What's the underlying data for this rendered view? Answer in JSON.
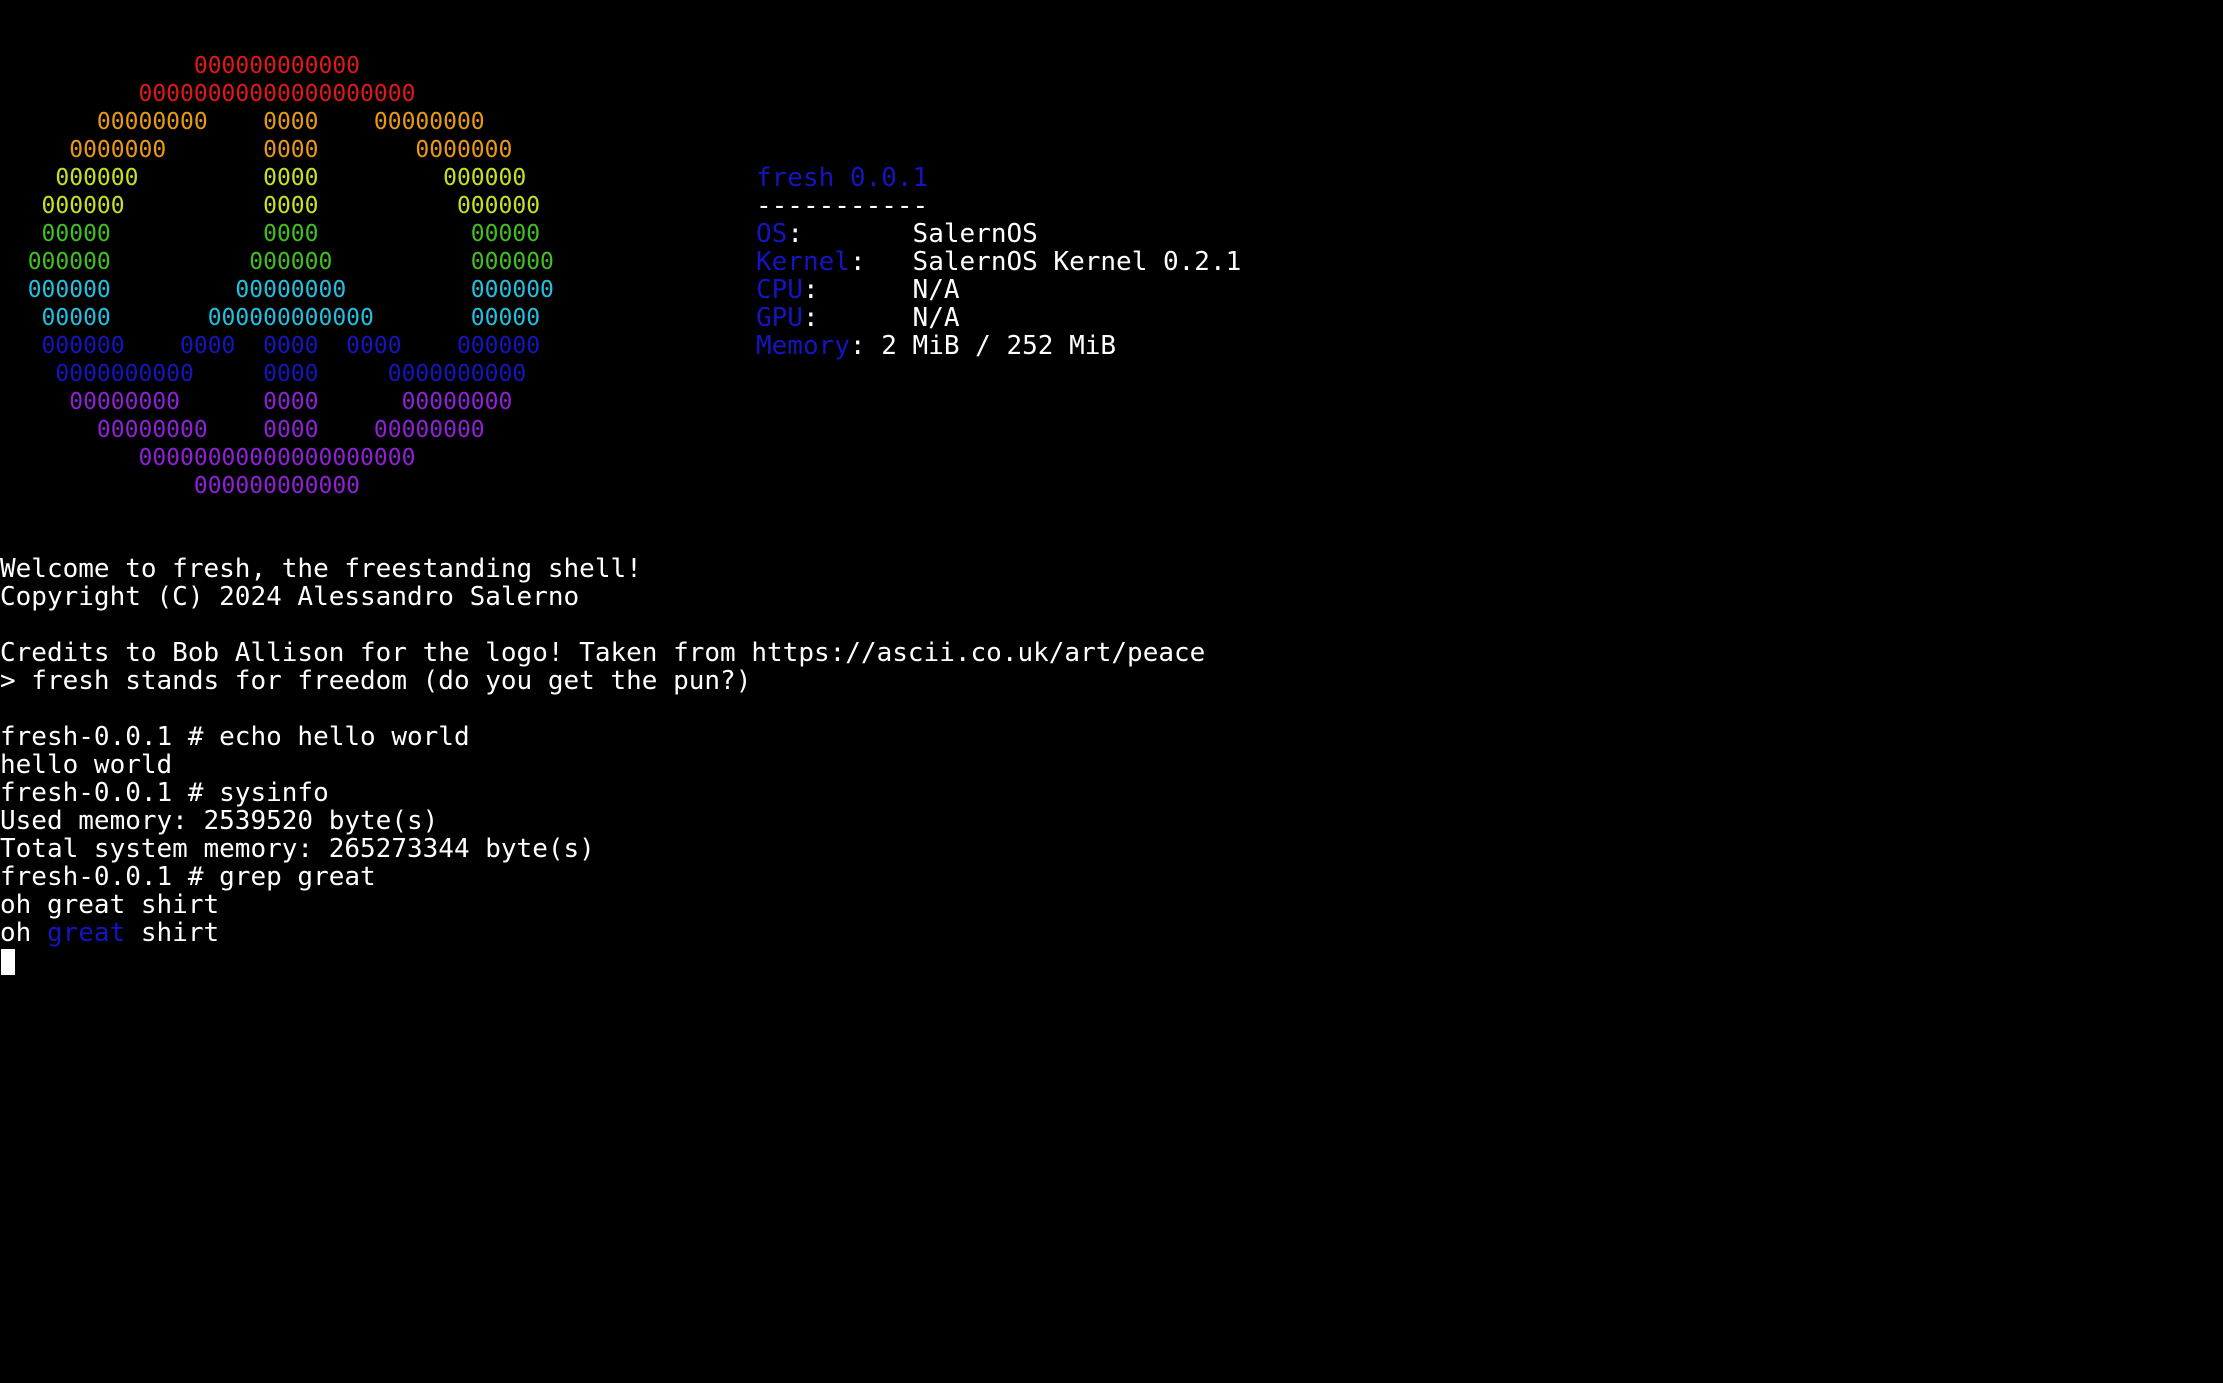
{
  "colors": {
    "background": "#000000",
    "text": "#ffffff",
    "accent_blue": "#1515c0",
    "logo": [
      "#e01818",
      "#e01818",
      "#e89a10",
      "#e89a10",
      "#c8e020",
      "#c8e020",
      "#40c020",
      "#40c020",
      "#20c0e0",
      "#20c0e0",
      "#1515c0",
      "#1515c0",
      "#9020d8",
      "#9020d8",
      "#9020d8",
      "#9020d8"
    ]
  },
  "logo": [
    "              000000000000",
    "          00000000000000000000",
    "       00000000    0000    00000000",
    "     0000000       0000       0000000",
    "    000000         0000         000000",
    "   000000          0000          000000",
    "   00000           0000           00000",
    "  000000          000000          000000",
    "  000000         00000000         000000",
    "   00000       000000000000       00000",
    "   000000    0000  0000  0000    000000",
    "    0000000000     0000     0000000000",
    "     00000000      0000      00000000",
    "       00000000    0000    00000000",
    "          00000000000000000000",
    "              000000000000"
  ],
  "sysinfo": {
    "title": "fresh 0.0.1",
    "separator": "-----------",
    "rows": [
      {
        "label": "OS",
        "pad": ":       ",
        "value": "SalernOS"
      },
      {
        "label": "Kernel",
        "pad": ":   ",
        "value": "SalernOS Kernel 0.2.1"
      },
      {
        "label": "CPU",
        "pad": ":      ",
        "value": "N/A"
      },
      {
        "label": "GPU",
        "pad": ":      ",
        "value": "N/A"
      },
      {
        "label": "Memory",
        "pad": ": ",
        "value": "2 MiB / 252 MiB"
      }
    ]
  },
  "output": {
    "welcome": "Welcome to fresh, the freestanding shell!",
    "copyright": "Copyright (C) 2024 Alessandro Salerno",
    "credits": "Credits to Bob Allison for the logo! Taken from https://ascii.co.uk/art/peace",
    "tagline": "> fresh stands for freedom (do you get the pun?)",
    "cmd1": "fresh-0.0.1 # echo hello world",
    "out1": "hello world",
    "cmd2": "fresh-0.0.1 # sysinfo",
    "out2a": "Used memory: 2539520 byte(s)",
    "out2b": "Total system memory: 265273344 byte(s)",
    "cmd3": "fresh-0.0.1 # grep great",
    "input3": "oh great shirt",
    "match_prefix": "oh ",
    "match_word": "great",
    "match_suffix": " shirt"
  }
}
